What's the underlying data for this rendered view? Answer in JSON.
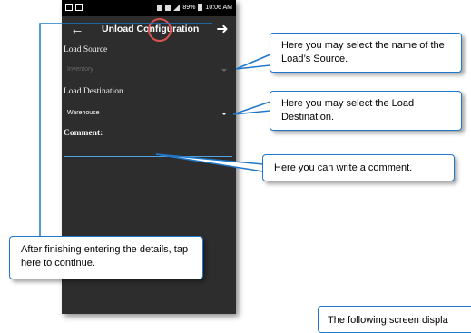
{
  "status_bar": {
    "battery": "89%",
    "time": "10:06 AM"
  },
  "app_bar": {
    "title": "Unload Configuration",
    "back_icon": "arrow-left-icon",
    "next_icon": "arrow-right-icon"
  },
  "form": {
    "load_source_label": "Load Source",
    "load_source_value": "Inventory",
    "load_destination_label": "Load Destination",
    "load_destination_value": "Warehouse",
    "comment_label": "Comment:",
    "comment_value": ""
  },
  "callouts": {
    "source": "Here you may select the name of the Load’s Source.",
    "destination": "Here you may select the Load Destination.",
    "comment": "Here you can write a comment.",
    "continue": "After finishing entering the details, tap here to continue.",
    "next_screen": "The following screen displa"
  },
  "colors": {
    "phone_bg": "#2d2d2d",
    "callout_border": "#1f78c8",
    "highlight": "#d9534f",
    "comment_underline": "#4fa3e0"
  }
}
